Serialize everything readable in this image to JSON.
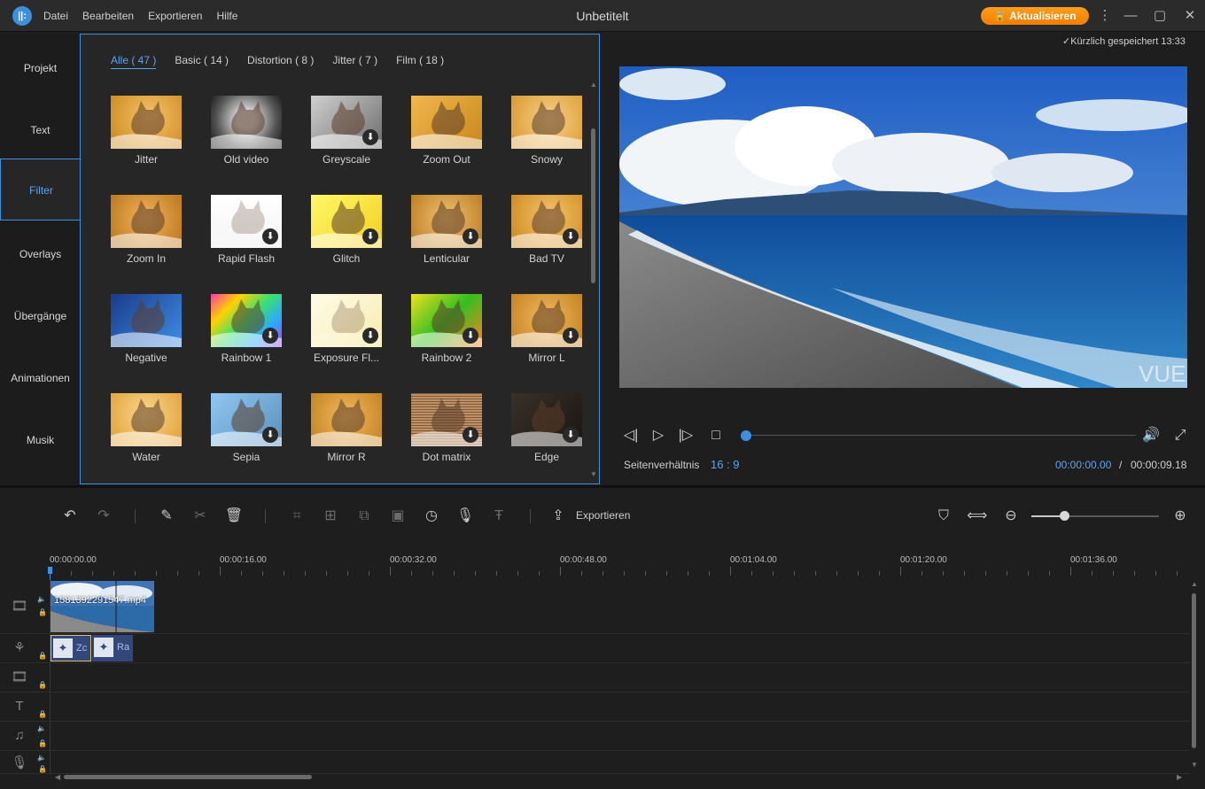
{
  "app": {
    "title": "Unbetitelt",
    "logo_text": "||:",
    "menu": [
      "Datei",
      "Bearbeiten",
      "Exportieren",
      "Hilfe"
    ],
    "upgrade_label": "Aktualisieren",
    "upgrade_color": "#f58a0a"
  },
  "categories": [
    "Projekt",
    "Text",
    "Filter",
    "Overlays",
    "Übergänge",
    "Animationen",
    "Musik"
  ],
  "active_category": "Filter",
  "filter_tabs": [
    "Alle ( 47 )",
    "Basic ( 14 )",
    "Distortion ( 8 )",
    "Jitter ( 7 )",
    "Film ( 18 )"
  ],
  "active_filter_tab": "Alle ( 47 )",
  "filters": [
    {
      "label": "Jitter",
      "download": false,
      "style": "orange"
    },
    {
      "label": "Old video",
      "download": false,
      "style": "vignette"
    },
    {
      "label": "Greyscale",
      "download": true,
      "style": "grey"
    },
    {
      "label": "Zoom Out",
      "download": false,
      "style": "zoomout"
    },
    {
      "label": "Snowy",
      "download": false,
      "style": "snowy"
    },
    {
      "label": "Zoom In",
      "download": false,
      "style": "zoomin"
    },
    {
      "label": "Rapid Flash",
      "download": true,
      "style": "white"
    },
    {
      "label": "Glitch",
      "download": true,
      "style": "yellow"
    },
    {
      "label": "Lenticular",
      "download": true,
      "style": "lenticular"
    },
    {
      "label": "Bad TV",
      "download": true,
      "style": "orange"
    },
    {
      "label": "Negative",
      "download": false,
      "style": "negative"
    },
    {
      "label": "Rainbow 1",
      "download": true,
      "style": "rainbow1"
    },
    {
      "label": "Exposure Fl...",
      "download": true,
      "style": "exposure"
    },
    {
      "label": "Rainbow 2",
      "download": true,
      "style": "rainbow2"
    },
    {
      "label": "Mirror L",
      "download": true,
      "style": "mirror"
    },
    {
      "label": "Water",
      "download": false,
      "style": "water"
    },
    {
      "label": "Sepia",
      "download": true,
      "style": "sepia"
    },
    {
      "label": "Mirror R",
      "download": false,
      "style": "mirror"
    },
    {
      "label": "Dot matrix",
      "download": true,
      "style": "dotmatrix"
    },
    {
      "label": "Edge",
      "download": true,
      "style": "edge"
    }
  ],
  "preview": {
    "saved_status": "Kürzlich gespeichert 13:33",
    "watermark": "VUE",
    "aspect_label": "Seitenverhältnis",
    "aspect_value": "16 : 9",
    "time_current": "00:00:00.00",
    "time_separator": "/",
    "time_total": "00:00:09.18",
    "progress": 0
  },
  "toolbar": {
    "export_label": "Exportieren",
    "zoom_level": 0.26
  },
  "timeline": {
    "ruler_labels": [
      "00:00:00.00",
      "00:00:16.00",
      "00:00:32.00",
      "00:00:48.00",
      "00:01:04.00",
      "00:01:20.00",
      "00:01:36.00"
    ],
    "video_clip_name": "1581392291547.mp4",
    "fx_clips": [
      {
        "name": "Zoom In",
        "visible_text": "Zc",
        "selected": true
      },
      {
        "name": "Rapid Flash",
        "visible_text": "Ra",
        "selected": false
      }
    ]
  },
  "colors": {
    "accent": "#3d8fe0",
    "background": "#1e1e1e",
    "panel": "#262626"
  }
}
